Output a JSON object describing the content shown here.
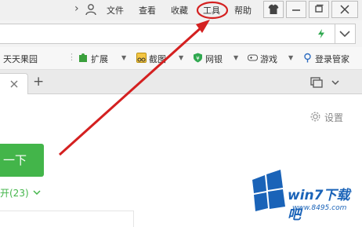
{
  "menu": {
    "items": [
      "文件",
      "查看",
      "收藏",
      "工具",
      "帮助"
    ]
  },
  "bookmarks": {
    "site": "天天果园",
    "items": [
      {
        "label": "扩展",
        "icon": "puzzle-icon"
      },
      {
        "label": "截图",
        "icon": "scissors-icon"
      },
      {
        "label": "网银",
        "icon": "shield-icon"
      },
      {
        "label": "游戏",
        "icon": "gamepad-icon"
      },
      {
        "label": "登录管家",
        "icon": "key-icon"
      }
    ]
  },
  "tabs": {
    "new_tab_symbol": "+"
  },
  "content": {
    "settings_label": "设置",
    "search_button_fragment": "一下",
    "expand_label": "开(23)"
  },
  "watermark": {
    "title": "win7下载吧",
    "url": "www.8495.com"
  },
  "colors": {
    "accent_green": "#43b54a",
    "annotation_red": "#d42020",
    "watermark_blue": "#1a63b8"
  }
}
